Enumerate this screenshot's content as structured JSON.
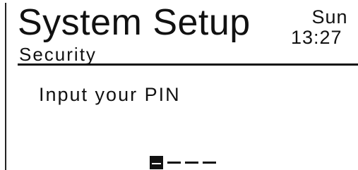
{
  "header": {
    "title": "System Setup",
    "subtitle": "Security",
    "day": "Sun",
    "time": "13:27"
  },
  "pin_screen": {
    "prompt": "Input your PIN",
    "pin_entry": {
      "digit_count": 4,
      "entered_count": 0,
      "active_index": 0
    }
  },
  "colors": {
    "background": "#ffffff",
    "foreground": "#111111"
  }
}
